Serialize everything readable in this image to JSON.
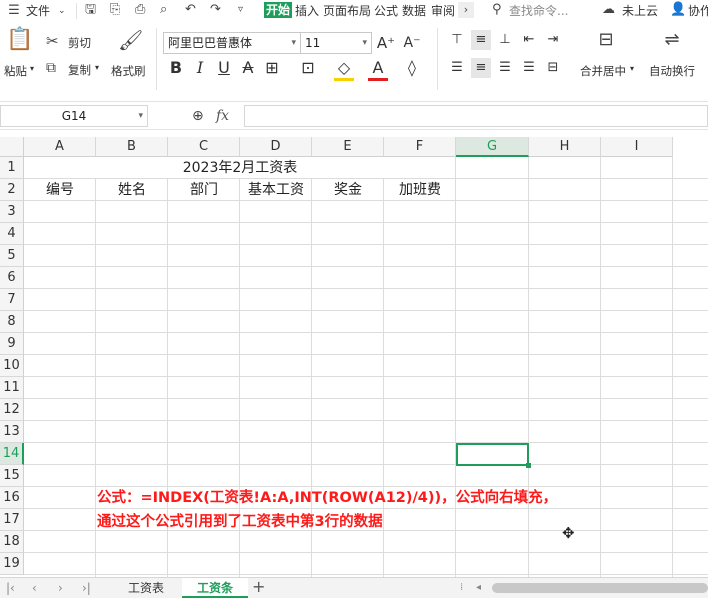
{
  "menubar": {
    "file_label": "文件",
    "tabs": [
      {
        "label": "开始",
        "active": true
      },
      {
        "label": "插入",
        "active": false
      },
      {
        "label": "页面布局",
        "active": false
      },
      {
        "label": "公式",
        "active": false
      },
      {
        "label": "数据",
        "active": false
      },
      {
        "label": "审阅",
        "active": false
      }
    ],
    "search_placeholder": "查找命令...",
    "cloud_label": "未上云",
    "collab_label": "协作"
  },
  "ribbon": {
    "paste_label": "粘贴",
    "cut_label": "剪切",
    "copy_label": "复制",
    "format_painter_label": "格式刷",
    "font_name": "阿里巴巴普惠体",
    "font_size": "11",
    "merge_label": "合并居中",
    "wrap_label": "自动换行"
  },
  "formula_bar": {
    "name_box": "G14",
    "fx_label": "fx",
    "formula": ""
  },
  "sheet": {
    "columns": [
      "A",
      "B",
      "C",
      "D",
      "E",
      "F",
      "G",
      "H",
      "I"
    ],
    "active_column": "G",
    "rows": [
      "1",
      "2",
      "3",
      "4",
      "5",
      "6",
      "7",
      "8",
      "9",
      "10",
      "11",
      "12",
      "13",
      "14",
      "15",
      "16",
      "17",
      "18",
      "19"
    ],
    "active_row": "14",
    "title": "2023年2月工资表",
    "headers": [
      "编号",
      "姓名",
      "部门",
      "基本工资",
      "奖金",
      "加班费"
    ],
    "note_line1": "公式：=INDEX(工资表!A:A,INT(ROW(A12)/4))，公式向右填充，",
    "note_line2": "通过这个公式引用到了工资表中第3行的数据"
  },
  "sheet_tabs": [
    {
      "label": "工资表",
      "active": false
    },
    {
      "label": "工资条",
      "active": true
    }
  ],
  "colors": {
    "accent": "#1e9e5a",
    "note": "#ff1a1a",
    "active_tab": "#1e9e5a"
  }
}
